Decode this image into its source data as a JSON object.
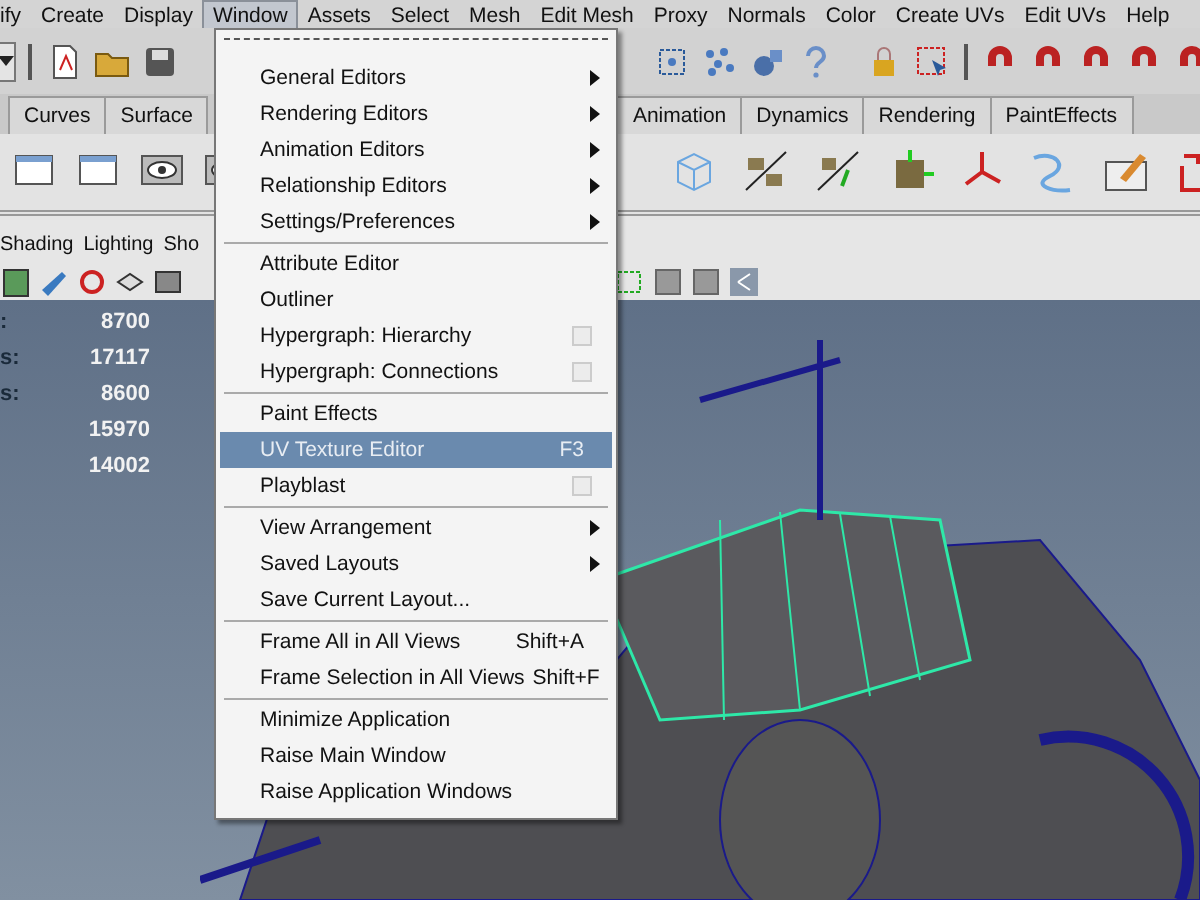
{
  "menubar": [
    {
      "label": "ify",
      "selected": false
    },
    {
      "label": "Create",
      "selected": false
    },
    {
      "label": "Display",
      "selected": false
    },
    {
      "label": "Window",
      "selected": true
    },
    {
      "label": "Assets",
      "selected": false
    },
    {
      "label": "Select",
      "selected": false
    },
    {
      "label": "Mesh",
      "selected": false
    },
    {
      "label": "Edit Mesh",
      "selected": false
    },
    {
      "label": "Proxy",
      "selected": false
    },
    {
      "label": "Normals",
      "selected": false
    },
    {
      "label": "Color",
      "selected": false
    },
    {
      "label": "Create UVs",
      "selected": false
    },
    {
      "label": "Edit UVs",
      "selected": false
    },
    {
      "label": "Help",
      "selected": false
    }
  ],
  "shelf_tabs": [
    {
      "label": "Curves",
      "selected": false
    },
    {
      "label": "Surface",
      "selected": false
    },
    {
      "label": "Animation",
      "selected": false
    },
    {
      "label": "Dynamics",
      "selected": false
    },
    {
      "label": "Rendering",
      "selected": false
    },
    {
      "label": "PaintEffects",
      "selected": false
    }
  ],
  "panel_menu": [
    "Shading",
    "Lighting",
    "Sho"
  ],
  "hud": [
    {
      "label": ":",
      "value": "8700"
    },
    {
      "label": "s:",
      "value": "17117"
    },
    {
      "label": "s:",
      "value": "8600"
    },
    {
      "value": "15970"
    },
    {
      "value": "14002"
    }
  ],
  "window_menu": [
    [
      {
        "label": "General Editors",
        "kind": "submenu",
        "selected": false
      },
      {
        "label": "Rendering Editors",
        "kind": "submenu",
        "selected": false
      },
      {
        "label": "Animation Editors",
        "kind": "submenu",
        "selected": false
      },
      {
        "label": "Relationship Editors",
        "kind": "submenu",
        "selected": false
      },
      {
        "label": "Settings/Preferences",
        "kind": "submenu",
        "selected": false
      }
    ],
    [
      {
        "label": "Attribute Editor",
        "kind": "plain",
        "selected": false
      },
      {
        "label": "Outliner",
        "kind": "plain",
        "selected": false
      },
      {
        "label": "Hypergraph: Hierarchy",
        "kind": "option",
        "selected": false
      },
      {
        "label": "Hypergraph: Connections",
        "kind": "option",
        "selected": false
      }
    ],
    [
      {
        "label": "Paint Effects",
        "kind": "plain",
        "selected": false
      },
      {
        "label": "UV Texture Editor",
        "kind": "shortcut",
        "shortcut": "F3",
        "selected": true
      },
      {
        "label": "Playblast",
        "kind": "option",
        "selected": false
      }
    ],
    [
      {
        "label": "View Arrangement",
        "kind": "submenu",
        "selected": false
      },
      {
        "label": "Saved Layouts",
        "kind": "submenu",
        "selected": false
      },
      {
        "label": "Save Current Layout...",
        "kind": "plain",
        "selected": false
      }
    ],
    [
      {
        "label": "Frame All in All Views",
        "kind": "shortcut",
        "shortcut": "Shift+A",
        "selected": false
      },
      {
        "label": "Frame Selection in All Views",
        "kind": "shortcut",
        "shortcut": "Shift+F",
        "selected": false
      }
    ],
    [
      {
        "label": "Minimize Application",
        "kind": "plain",
        "selected": false
      },
      {
        "label": "Raise Main Window",
        "kind": "plain",
        "selected": false
      },
      {
        "label": "Raise Application Windows",
        "kind": "plain",
        "selected": false
      }
    ]
  ]
}
